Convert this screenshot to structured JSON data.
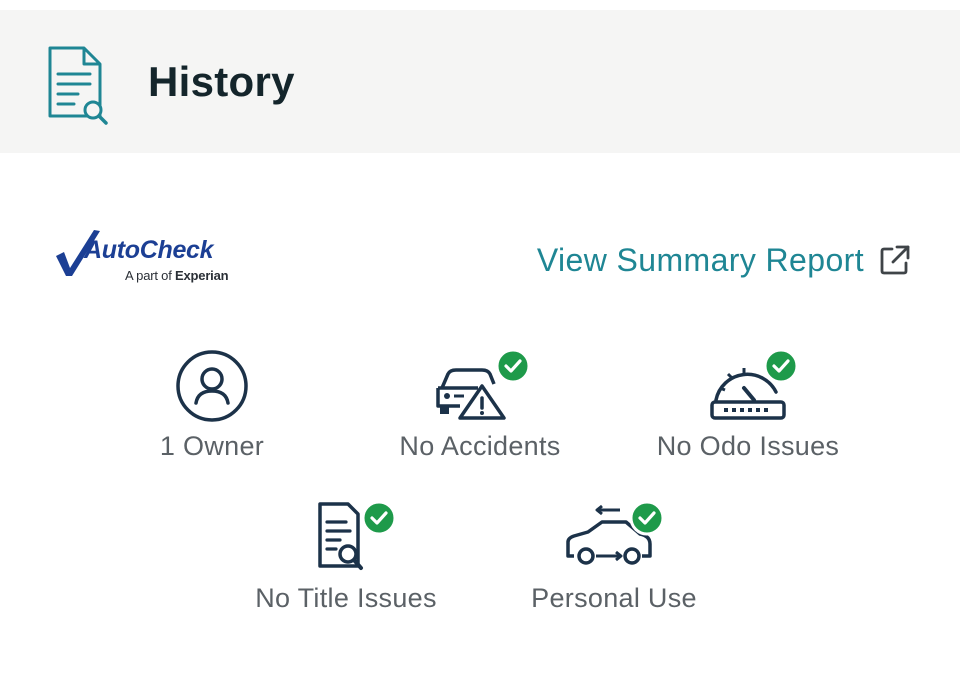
{
  "header": {
    "title": "History",
    "icon": "document-search-icon"
  },
  "brand": {
    "name": "AutoCheck",
    "tagline_prefix": "A part of",
    "tagline_company": "Experian",
    "colors": {
      "primary": "#1c3f94"
    }
  },
  "summary_link": {
    "label": "View Summary Report",
    "icon": "external-link-icon"
  },
  "features": [
    {
      "label": "1 Owner",
      "icon": "owner-icon",
      "checked": false
    },
    {
      "label": "No Accidents",
      "icon": "car-accident-icon",
      "checked": true
    },
    {
      "label": "No Odo Issues",
      "icon": "odometer-icon",
      "checked": true
    },
    {
      "label": "No Title Issues",
      "icon": "title-document-icon",
      "checked": true
    },
    {
      "label": "Personal Use",
      "icon": "personal-use-car-icon",
      "checked": true
    }
  ],
  "colors": {
    "accent": "#1f8694",
    "icon_navy": "#1c3249",
    "check_green": "#1e9a4a",
    "header_bg": "#f5f5f4"
  }
}
